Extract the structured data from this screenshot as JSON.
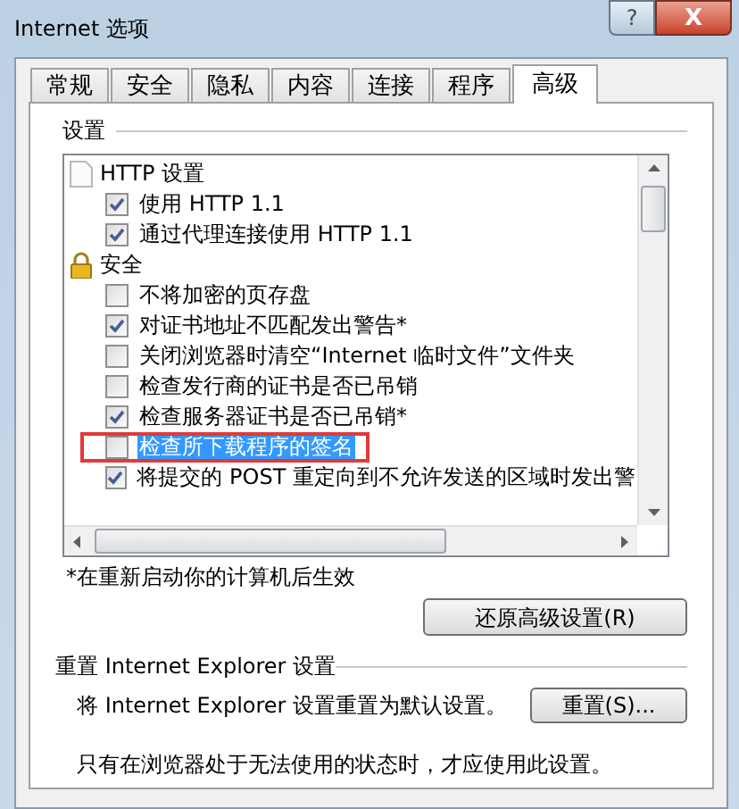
{
  "window": {
    "title": "Internet 选项",
    "buttons": [
      {
        "kind": "help",
        "label": "?"
      },
      {
        "kind": "close",
        "label": "X"
      }
    ]
  },
  "tabs": [
    {
      "label": "常规",
      "selected": false
    },
    {
      "label": "安全",
      "selected": false
    },
    {
      "label": "隐私",
      "selected": false
    },
    {
      "label": "内容",
      "selected": false
    },
    {
      "label": "连接",
      "selected": false
    },
    {
      "label": "程序",
      "selected": false
    },
    {
      "label": "高级",
      "selected": true
    }
  ],
  "settings": {
    "label": "设置",
    "groups": [
      {
        "title": "HTTP 设置",
        "kind": "page",
        "children": [
          {
            "label": "使用 HTTP 1.1",
            "checked": true,
            "selected": false
          },
          {
            "label": "通过代理连接使用 HTTP 1.1",
            "checked": true,
            "selected": false
          }
        ]
      },
      {
        "title": "安全",
        "kind": "lock",
        "children": [
          {
            "label": "不将加密的页存盘",
            "checked": false,
            "selected": false
          },
          {
            "label": "对证书地址不匹配发出警告*",
            "checked": true,
            "selected": false
          },
          {
            "label": "关闭浏览器时清空“Internet 临时文件”文件夹",
            "checked": false,
            "selected": false
          },
          {
            "label": "检查发行商的证书是否已吊销",
            "checked": false,
            "selected": false
          },
          {
            "label": "检查服务器证书是否已吊销*",
            "checked": true,
            "selected": false
          },
          {
            "label": "检查所下载程序的签名",
            "checked": false,
            "selected": true
          },
          {
            "label": "将提交的 POST 重定向到不允许发送的区域时发出警",
            "checked": true,
            "selected": false
          }
        ]
      }
    ],
    "footnote": "*在重新启动你的计算机后生效",
    "restore_button": "还原高级设置(R)"
  },
  "reset": {
    "label": "重置 Internet Explorer 设置",
    "description": "将 Internet Explorer 设置重置为默认设置。",
    "button": "重置(S)...",
    "note": "只有在浏览器处于无法使用的状态时，才应使用此设置。"
  }
}
